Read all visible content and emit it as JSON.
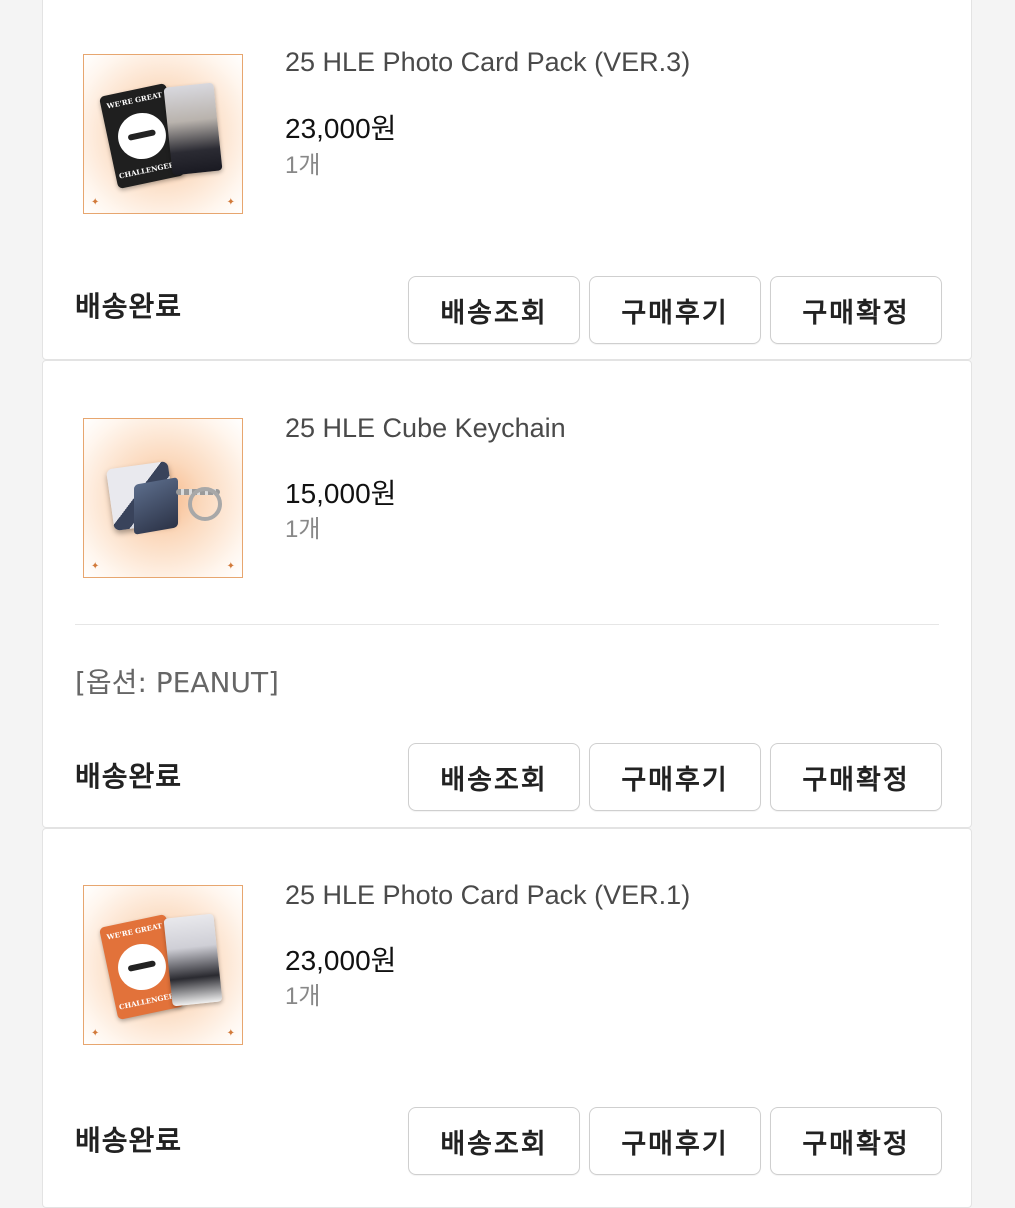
{
  "orders": [
    {
      "title": "25 HLE Photo Card Pack (VER.3)",
      "price": "23,000원",
      "qty": "1개",
      "status": "배송완료",
      "buttons": [
        "배송조회",
        "구매후기",
        "구매확정"
      ],
      "card_color": "#1f1f1f",
      "card_text_top": "WE'RE GREAT",
      "card_text_bottom": "CHALLENGERS"
    },
    {
      "title": "25 HLE Cube Keychain",
      "price": "15,000원",
      "qty": "1개",
      "option": "[옵션: PEANUT]",
      "status": "배송완료",
      "buttons": [
        "배송조회",
        "구매후기",
        "구매확정"
      ]
    },
    {
      "title": "25 HLE Photo Card Pack (VER.1)",
      "price": "23,000원",
      "qty": "1개",
      "status": "배송완료",
      "buttons": [
        "배송조회",
        "구매후기",
        "구매확정"
      ],
      "card_color": "#e2723a",
      "card_text_top": "WE'RE GREAT",
      "card_text_bottom": "CHALLENGERS"
    }
  ]
}
